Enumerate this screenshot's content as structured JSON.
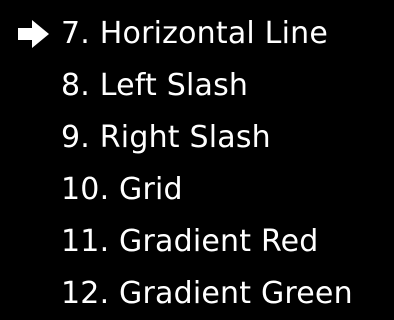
{
  "menu": {
    "selected_index": 0,
    "items": [
      {
        "label": "7. Horizontal Line"
      },
      {
        "label": "8. Left Slash"
      },
      {
        "label": "9. Right Slash"
      },
      {
        "label": "10. Grid"
      },
      {
        "label": "11. Gradient Red"
      },
      {
        "label": "12. Gradient Green"
      }
    ]
  },
  "colors": {
    "background": "#000000",
    "text": "#ffffff",
    "cursor": "#ffffff"
  },
  "icons": {
    "cursor": "right-arrow-icon"
  }
}
